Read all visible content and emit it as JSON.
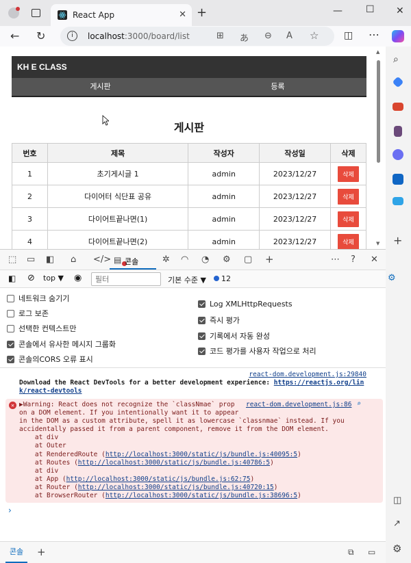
{
  "browser": {
    "tab_title": "React App",
    "tab_close": "✕",
    "new_tab": "+",
    "url_host": "localhost",
    "url_path": ":3000/board/list"
  },
  "page": {
    "header_title": "KH E CLASS",
    "nav": [
      "게시판",
      "등록"
    ],
    "board_title": "게시판",
    "table": {
      "headers": [
        "번호",
        "제목",
        "작성자",
        "작성일",
        "삭제"
      ],
      "rows": [
        [
          "1",
          "초기게시글 1",
          "admin",
          "2023/12/27"
        ],
        [
          "2",
          "다이어터 식단표 공유",
          "admin",
          "2023/12/27"
        ],
        [
          "3",
          "다이어트끝나면(1)",
          "admin",
          "2023/12/27"
        ],
        [
          "4",
          "다이어트끝나면(2)",
          "admin",
          "2023/12/27"
        ]
      ],
      "delete_label": "삭제"
    }
  },
  "devtools": {
    "console_tab": "콘솔",
    "context": "top ▼",
    "filter_placeholder": "필터",
    "level": "기본 수준 ▼",
    "issue_count": "12",
    "options_left": [
      {
        "label": "네트워크 숨기기",
        "checked": false
      },
      {
        "label": "로그 보존",
        "checked": false
      },
      {
        "label": "선택한 컨텍스트만",
        "checked": false
      },
      {
        "label": "콘솔에서 유사한 메시지 그룹화",
        "checked": true
      },
      {
        "label": "콘솔의CORS 오류 표시",
        "checked": true
      }
    ],
    "options_right": [
      {
        "label": "Log XMLHttpRequests",
        "checked": true
      },
      {
        "label": "즉시 평가",
        "checked": true
      },
      {
        "label": "기록에서 자동 완성",
        "checked": true
      },
      {
        "label": "코드 평가를 사용자 작업으로 처리",
        "checked": true
      }
    ],
    "info_source": "react-dom.development.js:29840",
    "info_line1_text": "Download the React DevTools for a better development experience: ",
    "info_line1_link": "https://reactjs.org/lin",
    "info_line2_link": "k/react-devtools",
    "error_source": "react-dom.development.js:86",
    "error_lines": [
      "▶Warning: React does not recognize the `classNmae` prop",
      "on a DOM element. If you intentionally want it to appear",
      "in the DOM as a custom attribute, spell it as lowercase `classnmae` instead. If you",
      "accidentally passed it from a parent component, remove it from the DOM element.",
      "    at div",
      "    at Outer",
      "    at RenderedRoute (http://localhost:3000/static/js/bundle.js:40095:5)",
      "    at Routes (http://localhost:3000/static/js/bundle.js:40786:5)",
      "    at div",
      "    at App (http://localhost:3000/static/js/bundle.js:62:75)",
      "    at Router (http://localhost:3000/static/js/bundle.js:40720:15)",
      "    at BrowserRouter (http://localhost:3000/static/js/bundle.js:38696:5)"
    ],
    "prompt": "›",
    "bottom_tab": "콘솔",
    "bottom_plus": "+"
  },
  "colors": {
    "header_bg": "#333333",
    "nav_bg": "#555555",
    "delete_btn": "#e84b3c",
    "accent": "#0f6cbd",
    "error_bg": "#fce8e8"
  }
}
